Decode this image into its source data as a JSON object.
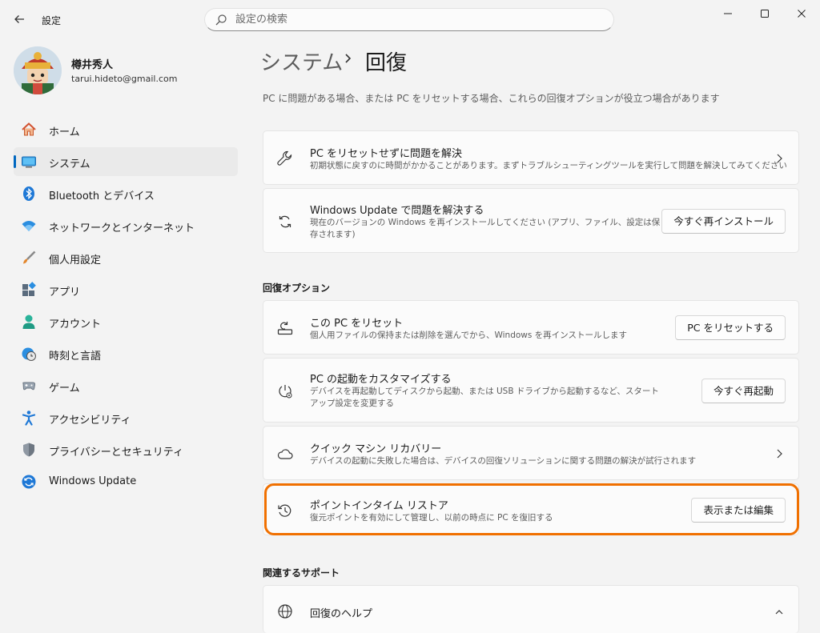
{
  "window": {
    "title": "設定"
  },
  "search": {
    "placeholder": "設定の検索"
  },
  "user": {
    "name": "樽井秀人",
    "email": "tarui.hideto@gmail.com"
  },
  "sidebar": {
    "items": [
      {
        "label": "ホーム",
        "icon": "home-icon"
      },
      {
        "label": "システム",
        "icon": "system-icon",
        "active": true
      },
      {
        "label": "Bluetooth とデバイス",
        "icon": "bluetooth-icon"
      },
      {
        "label": "ネットワークとインターネット",
        "icon": "wifi-icon"
      },
      {
        "label": "個人用設定",
        "icon": "brush-icon"
      },
      {
        "label": "アプリ",
        "icon": "apps-icon"
      },
      {
        "label": "アカウント",
        "icon": "account-icon"
      },
      {
        "label": "時刻と言語",
        "icon": "time-language-icon"
      },
      {
        "label": "ゲーム",
        "icon": "gamepad-icon"
      },
      {
        "label": "アクセシビリティ",
        "icon": "accessibility-icon"
      },
      {
        "label": "プライバシーとセキュリティ",
        "icon": "shield-icon"
      },
      {
        "label": "Windows Update",
        "icon": "update-icon"
      }
    ]
  },
  "main": {
    "breadcrumb": {
      "parent": "システム",
      "current": "回復"
    },
    "description": "PC に問題がある場合、または PC をリセットする場合、これらの回復オプションが役立つ場合があります",
    "cards_top": [
      {
        "title": "PC をリセットせずに問題を解決",
        "subtitle": "初期状態に戻すのに時間がかかることがあります。まずトラブルシューティングツールを実行して問題を解決してみてください",
        "icon": "wrench-icon"
      },
      {
        "title": "Windows Update で問題を解決する",
        "subtitle": "現在のバージョンの Windows を再インストールしてください (アプリ、ファイル、設定は保存されます)",
        "button": "今すぐ再インストール",
        "icon": "sync-icon"
      }
    ],
    "recovery_section": "回復オプション",
    "recovery_cards": [
      {
        "title": "この PC をリセット",
        "subtitle": "個人用ファイルの保持または削除を選んでから、Windows を再インストールします",
        "button": "PC をリセットする",
        "icon": "reset-pc-icon"
      },
      {
        "title": "PC の起動をカスタマイズする",
        "subtitle": "デバイスを再起動してディスクから起動、または USB ドライブから起動するなど、スタートアップ設定を変更する",
        "button": "今すぐ再起動",
        "icon": "startup-icon"
      },
      {
        "title": "クイック マシン リカバリー",
        "subtitle": "デバイスの起動に失敗した場合は、デバイスの回復ソリューションに関する問題の解決が試行されます",
        "icon": "cloud-icon"
      },
      {
        "title": "ポイントインタイム リストア",
        "subtitle": "復元ポイントを有効にして管理し、以前の時点に PC を復旧する",
        "button": "表示または編集",
        "icon": "history-icon"
      }
    ],
    "support_section": "関連するサポート",
    "support_cards": [
      {
        "title": "回復のヘルプ",
        "icon": "globe-icon"
      }
    ]
  },
  "colors": {
    "accent": "#0067c0",
    "highlight": "#f07000"
  }
}
